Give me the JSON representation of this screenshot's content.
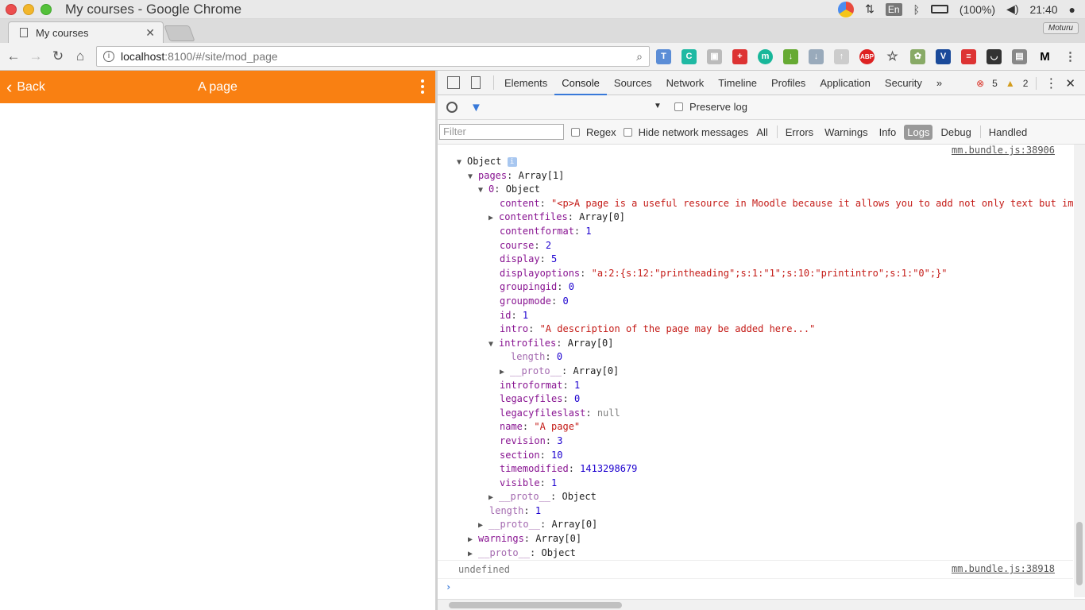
{
  "window": {
    "title": "My courses - Google Chrome"
  },
  "tray": {
    "lang": "En",
    "battery": "(100%)",
    "time": "21:40"
  },
  "tab": {
    "label": "My courses",
    "profile": "Moturu"
  },
  "address": {
    "host": "localhost",
    "path": ":8100/#/site/mod_page"
  },
  "app": {
    "back_label": "Back",
    "title": "A page"
  },
  "devtools": {
    "tabs": [
      "Elements",
      "Console",
      "Sources",
      "Network",
      "Timeline",
      "Profiles",
      "Application",
      "Security"
    ],
    "errors": "5",
    "warnings": "2",
    "preserve_log": "Preserve log",
    "filter_placeholder": "Filter",
    "regex": "Regex",
    "hide_network": "Hide network messages",
    "levels": [
      "All",
      "Errors",
      "Warnings",
      "Info",
      "Logs",
      "Debug",
      "Handled"
    ]
  },
  "console": {
    "source1": "mm.bundle.js:38906",
    "source2": "mm.bundle.js:38918",
    "root": "Object",
    "pages_key": "pages",
    "pages_val": "Array[1]",
    "idx_key": "0",
    "idx_val": "Object",
    "content_val": "\"<p>A page is a useful resource in Moodle because it allows you to add not only text but im",
    "contentfiles_val": "Array[0]",
    "contentformat_val": "1",
    "course_val": "2",
    "display_val": "5",
    "displayoptions_val": "\"a:2:{s:12:\"printheading\";s:1:\"1\";s:10:\"printintro\";s:1:\"0\";}\"",
    "groupingid_val": "0",
    "groupmode_val": "0",
    "id_val": "1",
    "intro_val": "\"A description of the page may be added here...\"",
    "introfiles_val": "Array[0]",
    "length0_val": "0",
    "proto_arr": "Array[0]",
    "introformat_val": "1",
    "legacyfiles_val": "0",
    "legacyfileslast_val": "null",
    "name_val": "\"A page\"",
    "revision_val": "3",
    "section_val": "10",
    "timemodified_val": "1413298679",
    "visible_val": "1",
    "proto_obj": "Object",
    "length1_val": "1",
    "warnings_val": "Array[0]",
    "undefined": "undefined"
  }
}
